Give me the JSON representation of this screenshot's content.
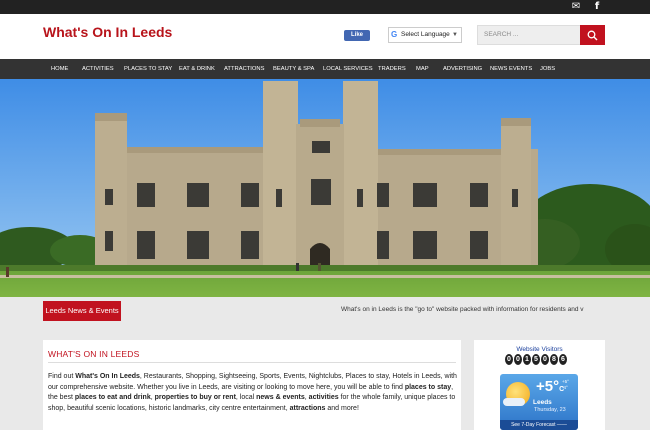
{
  "topbar": {
    "icons": [
      "email-icon",
      "facebook-icon"
    ]
  },
  "header": {
    "logo": "What's On In Leeds",
    "fb_like": "Like",
    "language_select": "Select Language",
    "search_placeholder": "SEARCH ..."
  },
  "nav": {
    "items": [
      "HOME",
      "ACTIVITIES",
      "PLACES TO STAY",
      "EAT & DRINK",
      "ATTRACTIONS",
      "BEAUTY & SPA",
      "LOCAL SERVICES",
      "TRADERS",
      "MAP",
      "ADVERTISING",
      "NEWS EVENTS",
      "JOBS"
    ]
  },
  "ticker": {
    "label": "Leeds News & Events",
    "text": "What's on in Leeds is the \"go to\" website packed with information for residents and v"
  },
  "main": {
    "heading": "WHAT'S ON IN LEEDS",
    "p1": "Find out ",
    "b1": "What's On In Leeds",
    "p2": ", Restaurants, Shopping, Sightseeing, Sports, Events, Nightclubs, Places to stay, Hotels in Leeds, with our comprehensive website. Whether you live in Leeds, are visiting or looking to move here, you will be able to find ",
    "b2": "places to stay",
    "p3": ", the best ",
    "b3": "places to eat and drink",
    "p4": ", ",
    "b4": "properties to buy or rent",
    "p5": ", local ",
    "b5": "news & events",
    "p6": ", ",
    "b6": "activities",
    "p7": " for the whole family, unique places to shop, beautiful scenic locations, historic landmarks, city centre entertainment, ",
    "b7": "attractions",
    "p8": " and more!"
  },
  "sidebar": {
    "visitors_title": "Website Visitors",
    "counter_digits": [
      "0",
      "0",
      "1",
      "5",
      "0",
      "8",
      "6"
    ],
    "weather": {
      "temp": "+5°",
      "unit": "C",
      "high": "+5°",
      "low": "-4°",
      "city": "Leeds",
      "date": "Thursday, 23",
      "forecast_link": "See 7-Day Forecast ——"
    }
  },
  "colors": {
    "brand_red": "#c1121f",
    "nav_bg": "#333333",
    "topbar_bg": "#222222"
  }
}
